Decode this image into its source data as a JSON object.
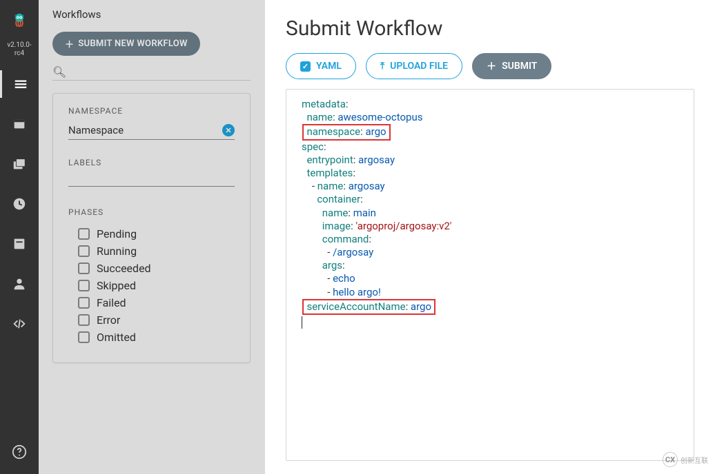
{
  "app": {
    "version_line1": "v2.10.0-",
    "version_line2": "rc4"
  },
  "sidebar": {
    "title": "Workflows",
    "submit_new_label": "SUBMIT NEW WORKFLOW",
    "namespace_header": "NAMESPACE",
    "namespace_value": "Namespace",
    "labels_header": "LABELS",
    "phases_header": "PHASES",
    "phases": [
      "Pending",
      "Running",
      "Succeeded",
      "Skipped",
      "Failed",
      "Error",
      "Omitted"
    ]
  },
  "main": {
    "title": "Submit Workflow",
    "buttons": {
      "yaml": "YAML",
      "upload": "UPLOAD FILE",
      "submit": "SUBMIT"
    }
  },
  "yaml": {
    "metadata_key": "metadata",
    "name_key": "name",
    "name_val": "awesome-octopus",
    "namespace_key": "namespace",
    "namespace_val": "argo",
    "spec_key": "spec",
    "entrypoint_key": "entrypoint",
    "entrypoint_val": "argosay",
    "templates_key": "templates",
    "tmpl_name_key": "name",
    "tmpl_name_val": "argosay",
    "container_key": "container",
    "c_name_key": "name",
    "c_name_val": "main",
    "image_key": "image",
    "image_val": "'argoproj/argosay:v2'",
    "command_key": "command",
    "command_val": "/argosay",
    "args_key": "args",
    "args_val1": "echo",
    "args_val2": "hello argo!",
    "san_key": "serviceAccountName",
    "san_val": "argo"
  },
  "watermark": "创新互联"
}
